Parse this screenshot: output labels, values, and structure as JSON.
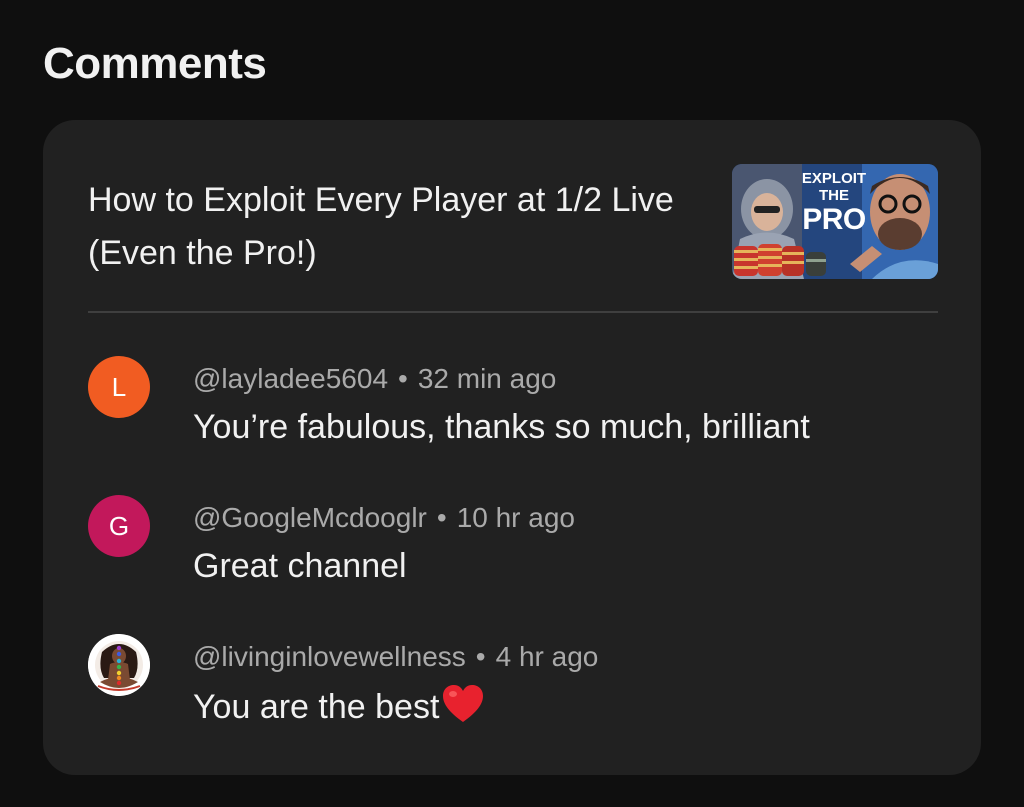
{
  "section": {
    "title": "Comments"
  },
  "video": {
    "title": "How to Exploit Every Player at 1/2 Live (Even the Pro!)",
    "thumbnail": {
      "line1": "EXPLOIT",
      "line2": "THE",
      "line3": "PRO"
    }
  },
  "comments": [
    {
      "avatar_letter": "L",
      "avatar_color": "#f15c22",
      "author": "@layladee5604",
      "separator": "•",
      "time": "32 min ago",
      "text": "You’re fabulous, thanks so much, brilliant"
    },
    {
      "avatar_letter": "G",
      "avatar_color": "#c2185b",
      "author": "@GoogleMcdooglr",
      "separator": "•",
      "time": "10 hr ago",
      "text": "Great channel"
    },
    {
      "avatar_letter": "",
      "avatar_color": "#ffffff",
      "author": "@livinginlovewellness",
      "separator": "•",
      "time": "4 hr ago",
      "text": "You are the best",
      "emoji": "heart-icon"
    }
  ],
  "colors": {
    "background": "#0f0f0f",
    "card": "#212121",
    "text_primary": "#f1f1f1",
    "text_secondary": "#aaaaaa",
    "heart": "#e8222e"
  }
}
